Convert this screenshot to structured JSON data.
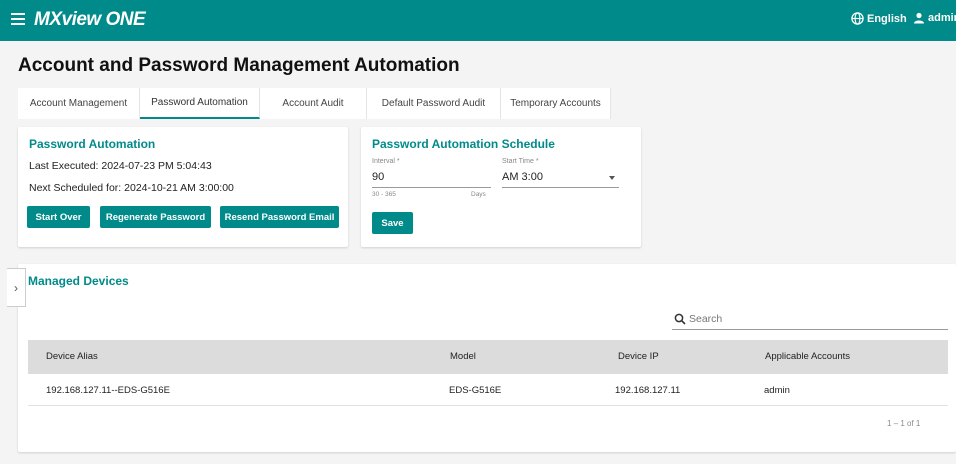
{
  "app": {
    "logo": "MXview ONE",
    "brand_color": "#008b8a"
  },
  "header": {
    "language": "English",
    "user": "admin"
  },
  "page": {
    "title": "Account and Password Management Automation"
  },
  "tabs": [
    {
      "label": "Account Management",
      "active": false
    },
    {
      "label": "Password Automation",
      "active": true
    },
    {
      "label": "Account Audit",
      "active": false
    },
    {
      "label": "Default Password Audit",
      "active": false
    },
    {
      "label": "Temporary Accounts",
      "active": false
    }
  ],
  "automation": {
    "title": "Password Automation",
    "last_executed": "Last Executed: 2024-07-23 PM 5:04:43",
    "next_scheduled": "Next Scheduled for: 2024-10-21 AM 3:00:00",
    "buttons": {
      "start_over": "Start Over",
      "regenerate": "Regenerate Password",
      "resend": "Resend Password Email"
    }
  },
  "schedule": {
    "title": "Password Automation Schedule",
    "interval": {
      "label": "Interval *",
      "value": "90",
      "hint_range": "30 - 365",
      "hint_unit": "Days"
    },
    "start_time": {
      "label": "Start Time *",
      "value": "AM 3:00"
    },
    "save_label": "Save"
  },
  "devices": {
    "title": "Managed Devices",
    "search_placeholder": "Search",
    "columns": [
      "Device Alias",
      "Model",
      "Device IP",
      "Applicable Accounts"
    ],
    "rows": [
      {
        "alias": "192.168.127.11--EDS-G516E",
        "model": "EDS-G516E",
        "ip": "192.168.127.11",
        "accounts": "admin"
      }
    ],
    "pagination": "1 – 1 of 1"
  }
}
